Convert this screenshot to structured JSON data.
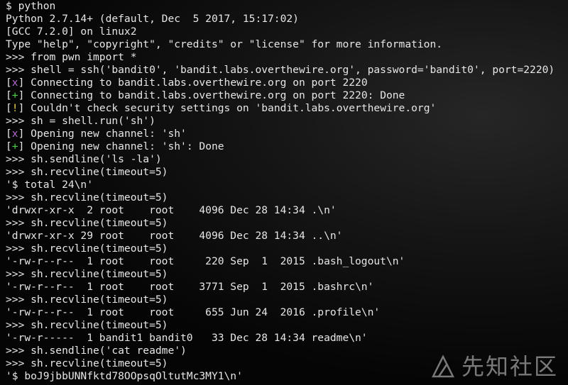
{
  "terminal": {
    "lines": [
      {
        "type": "plain",
        "text": "$ python"
      },
      {
        "type": "plain",
        "text": "Python 2.7.14+ (default, Dec  5 2017, 15:17:02)"
      },
      {
        "type": "plain",
        "text": "[GCC 7.2.0] on linux2"
      },
      {
        "type": "plain",
        "text": "Type \"help\", \"copyright\", \"credits\" or \"license\" for more information."
      },
      {
        "type": "plain",
        "text": ">>> from pwn import *"
      },
      {
        "type": "plain",
        "text": ">>> shell = ssh('bandit0', 'bandit.labs.overthewire.org', password='bandit0', port=2220)"
      },
      {
        "type": "status",
        "mark": "x",
        "text": " Connecting to bandit.labs.overthewire.org on port 2220"
      },
      {
        "type": "status",
        "mark": "+",
        "text": " Connecting to bandit.labs.overthewire.org on port 2220: Done"
      },
      {
        "type": "status",
        "mark": "!",
        "text": " Couldn't check security settings on 'bandit.labs.overthewire.org'"
      },
      {
        "type": "plain",
        "text": ">>> sh = shell.run('sh')"
      },
      {
        "type": "status",
        "mark": "x",
        "text": " Opening new channel: 'sh'"
      },
      {
        "type": "status",
        "mark": "+",
        "text": " Opening new channel: 'sh': Done"
      },
      {
        "type": "plain",
        "text": ">>> sh.sendline('ls -la')"
      },
      {
        "type": "plain",
        "text": ">>> sh.recvline(timeout=5)"
      },
      {
        "type": "plain",
        "text": "'$ total 24\\n'"
      },
      {
        "type": "plain",
        "text": ">>> sh.recvline(timeout=5)"
      },
      {
        "type": "plain",
        "text": "'drwxr-xr-x  2 root    root    4096 Dec 28 14:34 .\\n'"
      },
      {
        "type": "plain",
        "text": ">>> sh.recvline(timeout=5)"
      },
      {
        "type": "plain",
        "text": "'drwxr-xr-x 29 root    root    4096 Dec 28 14:34 ..\\n'"
      },
      {
        "type": "plain",
        "text": ">>> sh.recvline(timeout=5)"
      },
      {
        "type": "plain",
        "text": "'-rw-r--r--  1 root    root     220 Sep  1  2015 .bash_logout\\n'"
      },
      {
        "type": "plain",
        "text": ">>> sh.recvline(timeout=5)"
      },
      {
        "type": "plain",
        "text": "'-rw-r--r--  1 root    root    3771 Sep  1  2015 .bashrc\\n'"
      },
      {
        "type": "plain",
        "text": ">>> sh.recvline(timeout=5)"
      },
      {
        "type": "plain",
        "text": "'-rw-r--r--  1 root    root     655 Jun 24  2016 .profile\\n'"
      },
      {
        "type": "plain",
        "text": ">>> sh.recvline(timeout=5)"
      },
      {
        "type": "plain",
        "text": "'-rw-r-----  1 bandit1 bandit0   33 Dec 28 14:34 readme\\n'"
      },
      {
        "type": "plain",
        "text": ">>> sh.sendline('cat readme')"
      },
      {
        "type": "plain",
        "text": ">>> sh.recvline(timeout=5)"
      },
      {
        "type": "plain",
        "text": "'$ boJ9jbbUNNfktd78OOpsqOltutMc3MY1\\n'"
      }
    ]
  },
  "watermark": {
    "text": "先知社区",
    "icon": "xianzhi-logo-icon"
  },
  "colors": {
    "status_x": "#b06ad0",
    "status_plus": "#4fd04f",
    "status_bang": "#e8d14a",
    "text": "#e6e6e6",
    "background": "#0a0a0a"
  }
}
